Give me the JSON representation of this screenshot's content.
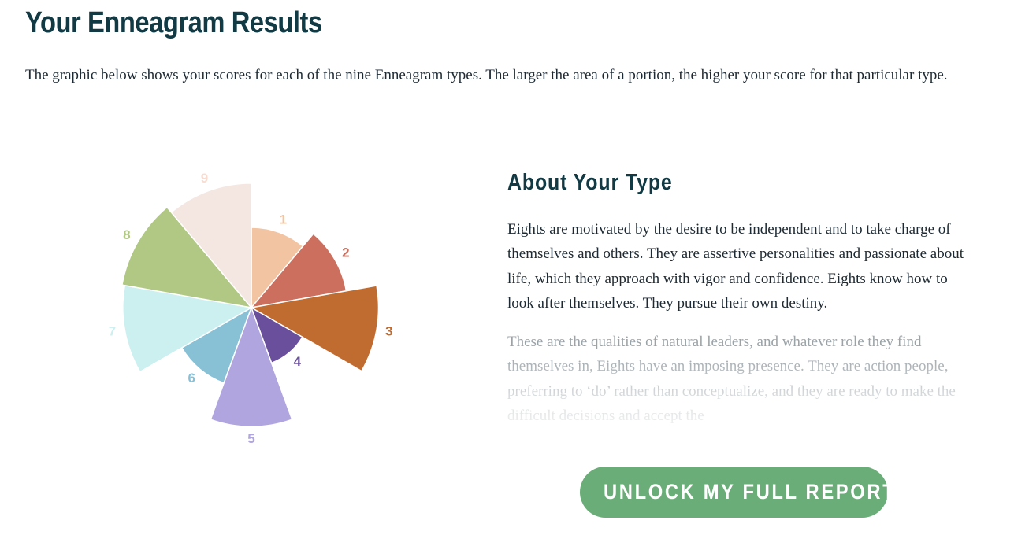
{
  "header": {
    "title": "Your Enneagram Results",
    "intro": "The graphic below shows your scores for each of the nine Enneagram types. The larger the area of a portion, the higher your score for that particular type."
  },
  "about": {
    "title": "About Your Type",
    "paragraph_1": "Eights are motivated by the desire to be independent and to take charge of themselves and others. They are assertive personalities and passionate about life, which they approach with vigor and confidence. Eights know how to look after themselves. They pursue their own destiny.",
    "paragraph_2": "These are the qualities of natural leaders, and whatever role they find themselves in, Eights have an imposing presence. They are action people, preferring to ‘do’ rather than conceptualize, and they are ready to make the difficult decisions and accept the"
  },
  "unlock_button": {
    "label": "UNLOCK MY FULL REPORT",
    "icon": "lock-icon",
    "color": "#6bad78"
  },
  "chart_data": {
    "type": "polar-area",
    "title": "",
    "categories": [
      "1",
      "2",
      "3",
      "4",
      "5",
      "6",
      "7",
      "8",
      "9"
    ],
    "values": [
      0.6,
      0.72,
      0.95,
      0.44,
      0.89,
      0.6,
      0.96,
      0.98,
      0.93
    ],
    "colors": [
      "#f2c4a2",
      "#cc6f5e",
      "#c06b30",
      "#6a509c",
      "#b0a5de",
      "#88c0d6",
      "#ccefef",
      "#b0c884",
      "#f4e6e1"
    ],
    "label_colors": [
      "#f2c4a2",
      "#cc6f5e",
      "#c06b30",
      "#6a509c",
      "#b0a5de",
      "#88c0d6",
      "#ccefef",
      "#b0c884",
      "#f9dcd0"
    ],
    "scale_note": "values are relative scores, 1.0 = maximum"
  }
}
